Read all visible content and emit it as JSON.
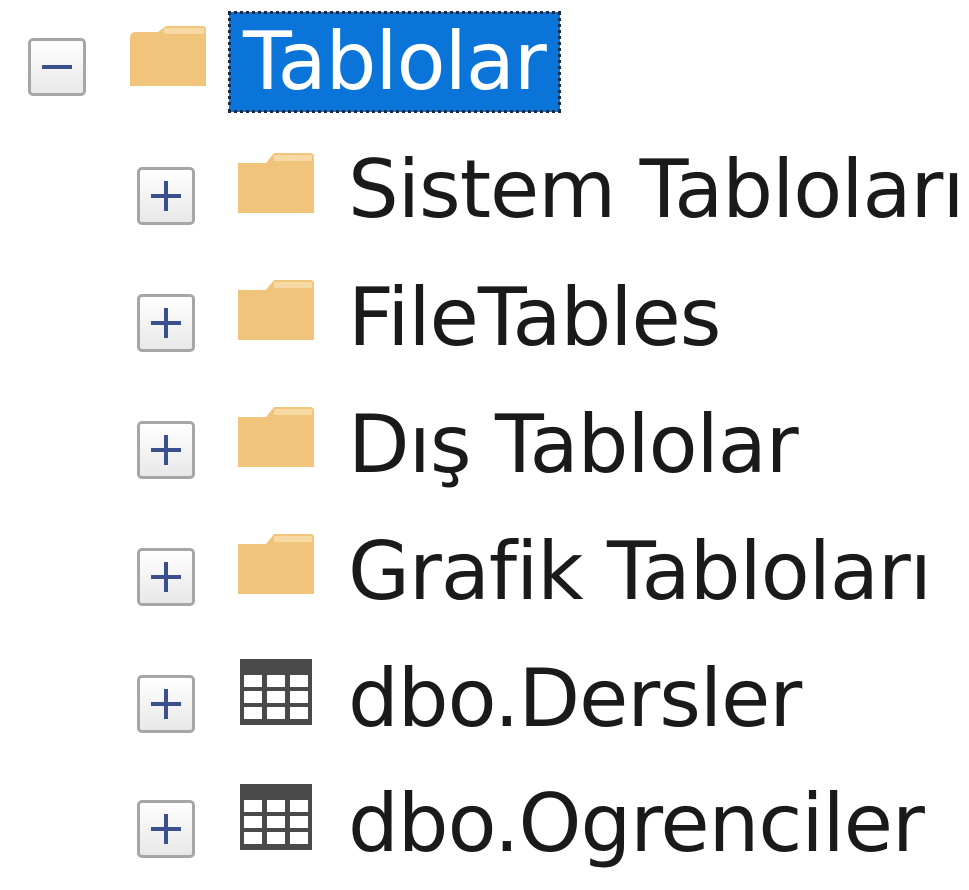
{
  "tree": {
    "root": {
      "label": "Tablolar",
      "expanded": true,
      "icon": "folder-icon",
      "selected": true
    },
    "children": [
      {
        "label": "Sistem Tabloları",
        "icon": "folder-icon",
        "expanded": false
      },
      {
        "label": "FileTables",
        "icon": "folder-icon",
        "expanded": false
      },
      {
        "label": "Dış Tablolar",
        "icon": "folder-icon",
        "expanded": false
      },
      {
        "label": "Grafik Tabloları",
        "icon": "folder-icon",
        "expanded": false
      },
      {
        "label": "dbo.Dersler",
        "icon": "table-icon",
        "expanded": false
      },
      {
        "label": "dbo.Ogrenciler",
        "icon": "table-icon",
        "expanded": false
      }
    ]
  },
  "colors": {
    "selection": "#0a74d9",
    "folder": "#f0c47a",
    "table": "#4a4a4a",
    "expander_glyph": "#3a4f8c"
  }
}
